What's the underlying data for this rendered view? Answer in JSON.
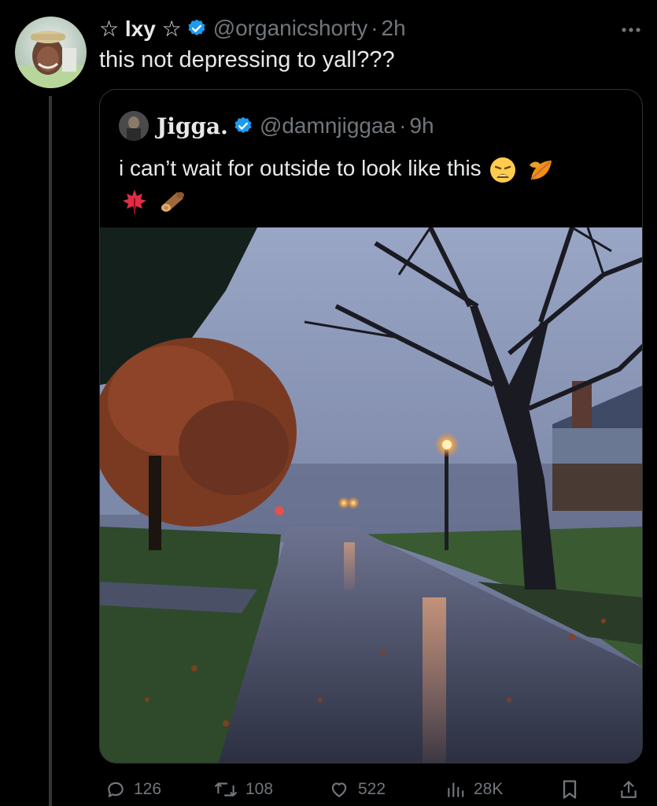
{
  "tweet": {
    "display_name": "☆ lxy ☆",
    "handle": "@organicshorty",
    "separator": "·",
    "time": "2h",
    "text": "this not depressing to yall???"
  },
  "quoted_tweet": {
    "display_name": "Jigga.",
    "handle": "@damnjiggaa",
    "separator": "·",
    "time": "9h",
    "text": "i can’t wait for outside to look like this",
    "emojis": [
      "weary-face",
      "fallen-leaf",
      "maple-leaf",
      "wood-log"
    ]
  },
  "actions": {
    "replies": "126",
    "retweets": "108",
    "likes": "522",
    "views": "28K"
  },
  "colors": {
    "background": "#000000",
    "text_primary": "#e7e9ea",
    "text_secondary": "#71767b",
    "verified_blue": "#1d9bf0",
    "card_border": "#2f3336"
  }
}
